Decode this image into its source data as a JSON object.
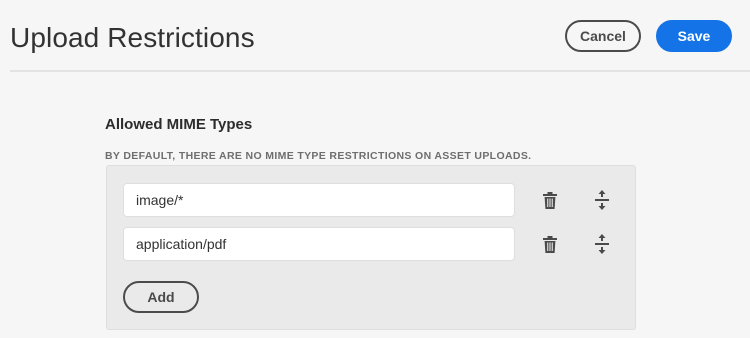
{
  "header": {
    "title": "Upload Restrictions",
    "cancel_label": "Cancel",
    "save_label": "Save"
  },
  "section": {
    "title": "Allowed MIME Types",
    "description": "BY DEFAULT, THERE ARE NO MIME TYPE RESTRICTIONS ON ASSET UPLOADS.",
    "rows": [
      {
        "value": "image/*",
        "delete_icon": "trash-icon",
        "reorder_icon": "reorder-icon"
      },
      {
        "value": "application/pdf",
        "delete_icon": "trash-icon",
        "reorder_icon": "reorder-icon"
      }
    ],
    "add_label": "Add"
  },
  "colors": {
    "accent": "#1473e6",
    "background": "#f6f6f6",
    "panel": "#eaeaea"
  }
}
